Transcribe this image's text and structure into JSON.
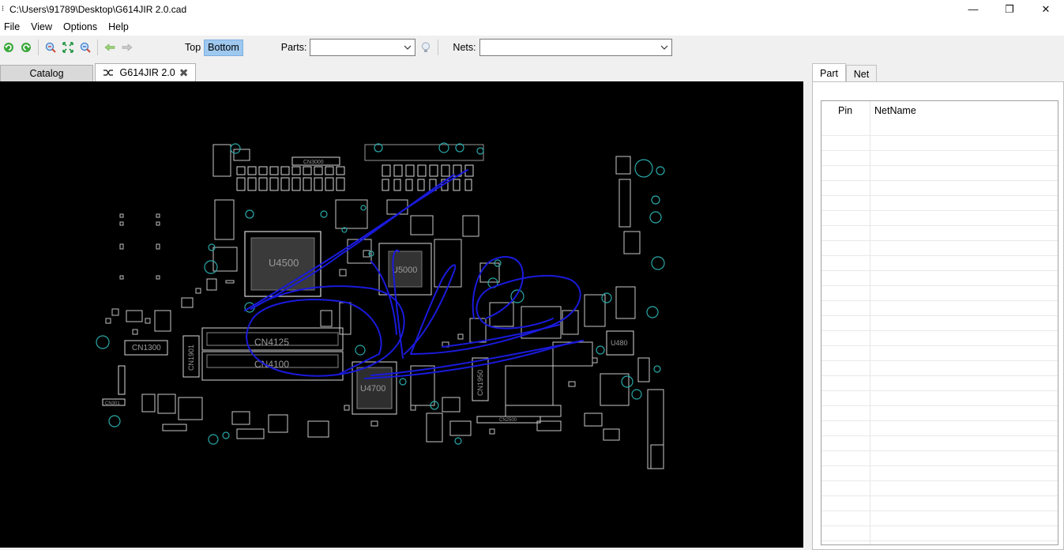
{
  "window": {
    "title": "C:\\Users\\91789\\Desktop\\G614JIR 2.0.cad",
    "minimize_glyph": "—",
    "restore_glyph": "❐",
    "close_glyph": "✕"
  },
  "menu": {
    "items": [
      "File",
      "View",
      "Options",
      "Help"
    ]
  },
  "toolbar": {
    "layer_top": "Top",
    "layer_bottom": "Bottom",
    "parts_label": "Parts:",
    "parts_value": "",
    "nets_label": "Nets:",
    "nets_value": ""
  },
  "tabs": {
    "catalog": "Catalog",
    "document": "G614JIR 2.0",
    "close_glyph": "✖"
  },
  "board": {
    "components": [
      "U4500",
      "CN4125",
      "CN4100",
      "CN1300",
      "CN1901",
      "CN1950",
      "U480",
      "U5000",
      "U4700",
      "CN3000",
      "CN301",
      "CN2500"
    ]
  },
  "right_panel": {
    "tab_part": "Part",
    "tab_net": "Net",
    "col_pin": "Pin",
    "col_netname": "NetName"
  },
  "colors": {
    "canvas_bg": "#000000",
    "trace": "#1a1adc",
    "silk": "#d8d8d8",
    "via": "#2aa8a8",
    "active_layer": "#9ec8ee"
  }
}
